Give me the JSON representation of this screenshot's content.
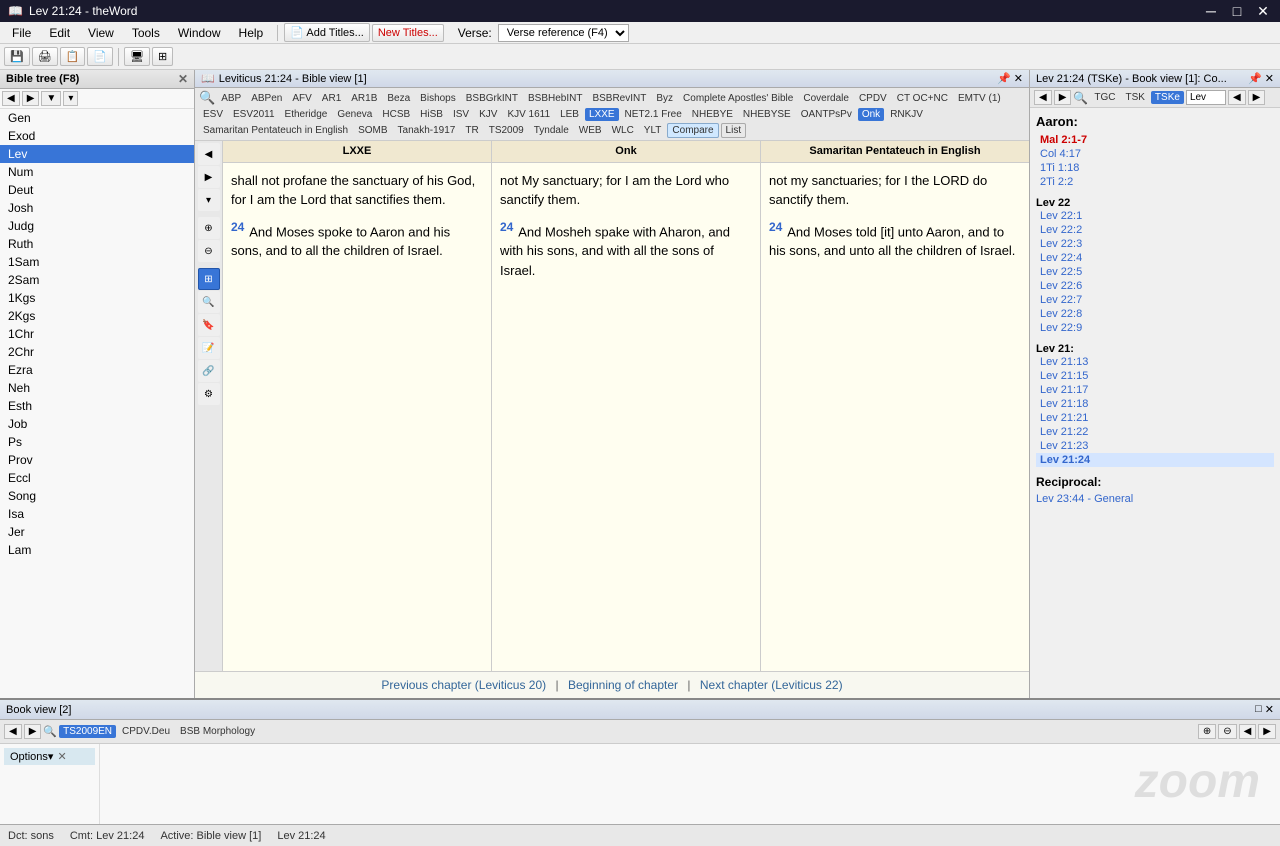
{
  "titlebar": {
    "icon": "📖",
    "title": "Lev 21:24 - theWord",
    "minimize": "─",
    "maximize": "□",
    "close": "✕"
  },
  "menubar": {
    "items": [
      "File",
      "Edit",
      "View",
      "Tools",
      "Window",
      "Help"
    ],
    "buttons": [
      "Add Titles...",
      "New Titles..."
    ],
    "verse_label": "Verse:",
    "verse_value": "Verse reference (F4)"
  },
  "toolbar_icons": [
    "💾",
    "🖨",
    "📋",
    "📄"
  ],
  "bible_tree": {
    "title": "Bible tree (F8)",
    "nav_buttons": [
      "◀",
      "▶",
      "▼",
      "▲"
    ],
    "books": [
      "Gen",
      "Exod",
      "Lev",
      "Num",
      "Deut",
      "Josh",
      "Judg",
      "Ruth",
      "1Sam",
      "2Sam",
      "1Kgs",
      "2Kgs",
      "1Chr",
      "2Chr",
      "Ezra",
      "Neh",
      "Esth",
      "Job",
      "Ps",
      "Prov",
      "Eccl",
      "Song",
      "Isa",
      "Jer",
      "Lam"
    ],
    "selected_book": "Lev"
  },
  "bible_view": {
    "title": "Leviticus 21:24 - Bible view [1]",
    "versions": [
      "ABP",
      "ABPen",
      "AFV",
      "AR1",
      "AR1B",
      "Beza",
      "Bishops",
      "BSBGrkINT",
      "BSBHebINT",
      "BSBRevINT",
      "Byz",
      "Complete Apostles' Bible",
      "Coverdale",
      "CPDV",
      "CT OC+NC",
      "EMTV (1)",
      "ESV",
      "ESV2011",
      "Etheridge",
      "Geneva",
      "HCSB",
      "HiSB",
      "ISV",
      "KJV",
      "KJV 1611",
      "LEB",
      "LXXE",
      "NET2.1 Free",
      "NHEBYE",
      "NHEBYSE",
      "OANTPsPv",
      "Onk",
      "RNKJV",
      "Samaritan Pentateuch in English",
      "SOMB",
      "Tanakh-1917",
      "TR",
      "TS2009",
      "Tyndale",
      "WEB",
      "WLC",
      "YLT",
      "Compare",
      "List"
    ],
    "active_versions": [
      "LXXE",
      "Onk"
    ],
    "compare_active": true,
    "columns": [
      {
        "header": "LXXE",
        "verses": [
          {
            "num": "",
            "text": "shall not profane the sanctuary of his God, for I am the Lord that sanctifies them."
          },
          {
            "num": "24",
            "text": "And Moses spoke to Aaron and his sons, and to all the children of Israel."
          }
        ]
      },
      {
        "header": "Onk",
        "verses": [
          {
            "num": "",
            "text": "not My sanctuary; for I am the Lord who sanctify them."
          },
          {
            "num": "24",
            "text": "And Mosheh spake with Aharon, and with his sons, and with all the sons of Israel."
          }
        ]
      },
      {
        "header": "Samaritan Pentateuch in English",
        "verses": [
          {
            "num": "",
            "text": "not my sanctuaries; for I the LORD do sanctify them."
          },
          {
            "num": "24",
            "text": "And Moses told [it] unto Aaron, and to his sons, and unto all the children of Israel."
          }
        ]
      }
    ],
    "navigation": {
      "prev": "Previous chapter (Leviticus 20)",
      "current": "Beginning of chapter",
      "next": "Next chapter (Leviticus 22)"
    }
  },
  "book_view": {
    "title": "Lev 21:24 (TSKe) - Book view [1]: Co...",
    "toolbar_versions": [
      "TGC",
      "TSK",
      "TSKe"
    ],
    "active_version": "TSKe",
    "lev_input": "Lev",
    "aaron_section": {
      "title": "Aaron:",
      "refs": [
        {
          "label": "Mal 2:1-7",
          "active": true
        },
        {
          "label": "Col 4:17",
          "active": false
        },
        {
          "label": "1Ti 1:18",
          "active": false
        },
        {
          "label": "2Ti 2:2",
          "active": false
        }
      ]
    },
    "lev_section": {
      "title": "Lev 21:",
      "refs": [
        "Lev 21:13",
        "Lev 21:15",
        "Lev 21:17",
        "Lev 21:18",
        "Lev 21:21",
        "Lev 21:22",
        "Lev 21:23",
        "Lev 21:24"
      ],
      "selected": "Lev 21:24"
    },
    "lev22_section": {
      "title": "Lev 22",
      "refs": [
        "Lev 22:1",
        "Lev 22:2",
        "Lev 22:3",
        "Lev 22:4",
        "Lev 22:5",
        "Lev 22:6",
        "Lev 22:7",
        "Lev 22:8",
        "Lev 22:9"
      ]
    },
    "reciprocal": {
      "title": "Reciprocal:",
      "items": [
        "Lev 23:44 - General"
      ]
    }
  },
  "bottom_panel": {
    "title": "Book view [2]",
    "search_versions": [
      "TS2009EN",
      "CPDV.Deu",
      "BSB Morphology"
    ],
    "options_label": "Options▾",
    "zoom_text": "zoom"
  },
  "statusbar": {
    "dct": "Dct: sons",
    "cmt": "Cmt: Lev 21:24",
    "active": "Active: Bible view [1]",
    "verse": "Lev 21:24"
  }
}
